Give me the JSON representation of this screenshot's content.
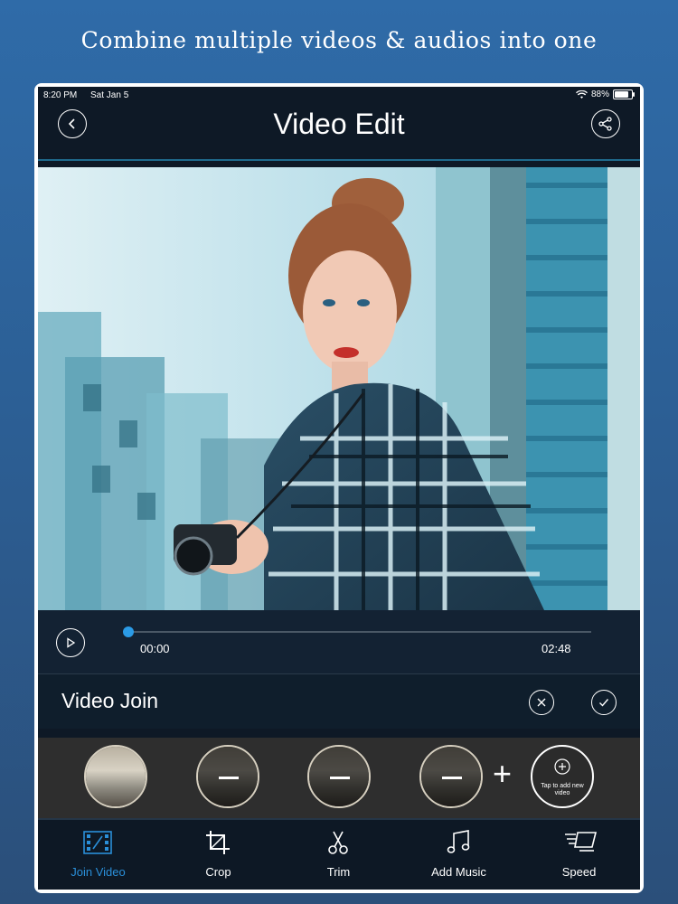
{
  "promo": {
    "headline": "Combine multiple videos & audios into one"
  },
  "status_bar": {
    "time": "8:20 PM",
    "date": "Sat Jan 5",
    "battery": "88%"
  },
  "header": {
    "title": "Video Edit"
  },
  "player": {
    "current_time": "00:00",
    "duration": "02:48",
    "progress": 0.0
  },
  "join_panel": {
    "title": "Video Join"
  },
  "clips": {
    "add_new_label": "Tap to add new video"
  },
  "tabs": [
    {
      "label": "Join Video",
      "icon": "film-icon",
      "active": true
    },
    {
      "label": "Crop",
      "icon": "crop-icon",
      "active": false
    },
    {
      "label": "Trim",
      "icon": "scissors-icon",
      "active": false
    },
    {
      "label": "Add Music",
      "icon": "music-note-icon",
      "active": false
    },
    {
      "label": "Speed",
      "icon": "speed-icon",
      "active": false
    }
  ],
  "colors": {
    "accent": "#2a8fd9",
    "screen_bg": "#0e1926",
    "panel_bg": "#132233"
  }
}
